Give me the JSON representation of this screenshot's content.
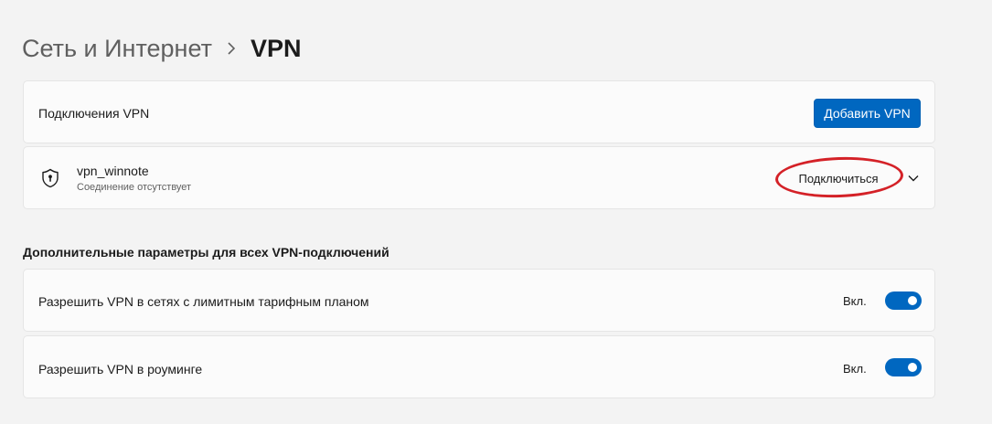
{
  "breadcrumb": {
    "parent": "Сеть и Интернет",
    "separator": "›",
    "current": "VPN"
  },
  "connections": {
    "label": "Подключения VPN",
    "add_button_label": "Добавить VPN"
  },
  "vpn_entry": {
    "icon": "shield-icon",
    "name": "vpn_winnote",
    "status": "Соединение отсутствует",
    "connect_label": "Подключиться",
    "expand_icon": "chevron-down-icon"
  },
  "advanced": {
    "title": "Дополнительные параметры для всех VPN-подключений",
    "settings": [
      {
        "label": "Разрешить VPN в сетях с лимитным тарифным планом",
        "state_label": "Вкл.",
        "on": true
      },
      {
        "label": "Разрешить VPN в роуминге",
        "state_label": "Вкл.",
        "on": true
      }
    ]
  },
  "colors": {
    "accent": "#0067c0",
    "annotation": "#d42127",
    "background": "#f3f3f3",
    "card": "#fbfbfb"
  }
}
